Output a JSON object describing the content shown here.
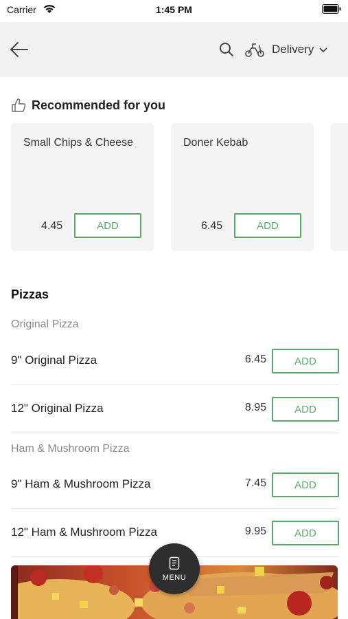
{
  "status_bar": {
    "carrier": "Carrier",
    "time": "1:45 PM"
  },
  "header": {
    "delivery_label": "Delivery"
  },
  "recommended": {
    "title": "Recommended for you",
    "items": [
      {
        "name": "Small Chips & Cheese",
        "price": "4.45",
        "add_label": "ADD"
      },
      {
        "name": "Doner Kebab",
        "price": "6.45",
        "add_label": "ADD"
      }
    ]
  },
  "menu": {
    "section_title": "Pizzas",
    "groups": [
      {
        "title": "Original Pizza",
        "items": [
          {
            "name": "9\" Original Pizza",
            "price": "6.45",
            "add_label": "ADD"
          },
          {
            "name": "12\" Original Pizza",
            "price": "8.95",
            "add_label": "ADD"
          }
        ]
      },
      {
        "title": "Ham & Mushroom Pizza",
        "items": [
          {
            "name": "9\" Ham & Mushroom Pizza",
            "price": "7.45",
            "add_label": "ADD"
          },
          {
            "name": "12\" Ham & Mushroom Pizza",
            "price": "9.95",
            "add_label": "ADD"
          }
        ]
      }
    ]
  },
  "fab": {
    "label": "MENU"
  },
  "colors": {
    "accent_green": "#5aa96a",
    "header_bg": "#f2f2f2",
    "card_bg": "#f4f4f4",
    "fab_bg": "#2e2e2e"
  }
}
